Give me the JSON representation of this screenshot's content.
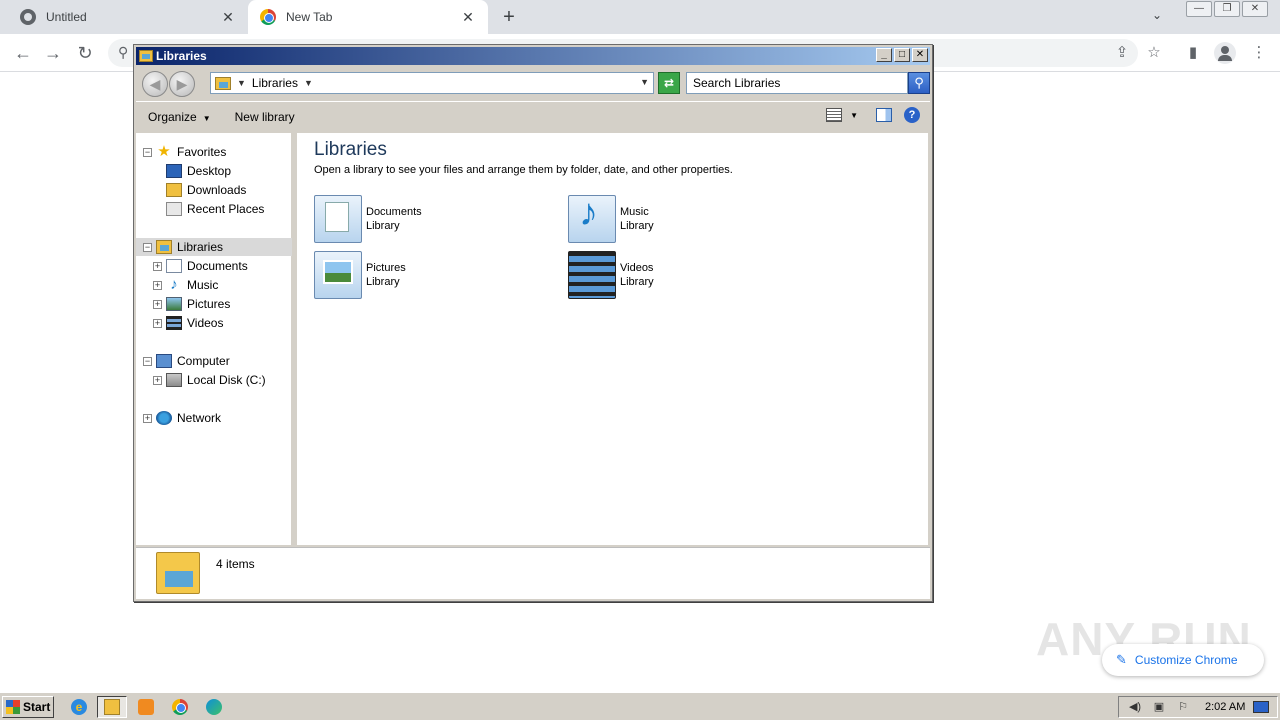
{
  "browser": {
    "tabs": [
      {
        "title": "Untitled",
        "close": "✕"
      },
      {
        "title": "New Tab",
        "close": "✕"
      }
    ],
    "new_tab": "+",
    "tab_search": "⌄",
    "window_controls": [
      "—",
      "❐",
      "✕"
    ],
    "nav": {
      "back": "←",
      "forward": "→",
      "reload": "↻"
    },
    "omnibox_icon": "search-icon",
    "toolbar_icons": [
      "share-icon",
      "star-icon",
      "side-panel-icon",
      "profile-icon",
      "menu-icon"
    ],
    "customize_label": "Customize Chrome",
    "watermark": "ANY RUN"
  },
  "explorer": {
    "title": "Libraries",
    "title_buttons": [
      "_",
      "□",
      "✕"
    ],
    "address": {
      "crumb": "Libraries"
    },
    "search_placeholder": "Search Libraries",
    "commands": {
      "organize": "Organize",
      "new_library": "New library"
    },
    "help": "?",
    "nav_tree": [
      {
        "label": "Favorites",
        "icon": "star-icon",
        "expander": "−",
        "level": 0
      },
      {
        "label": "Desktop",
        "icon": "desktop-icon",
        "level": 1
      },
      {
        "label": "Downloads",
        "icon": "downloads-icon",
        "level": 1
      },
      {
        "label": "Recent Places",
        "icon": "recent-places-icon",
        "level": 1
      },
      {
        "label": "Libraries",
        "icon": "libraries-icon",
        "expander": "−",
        "level": 0,
        "selected": true
      },
      {
        "label": "Documents",
        "icon": "documents-icon",
        "expander": "+",
        "level": 1
      },
      {
        "label": "Music",
        "icon": "music-icon",
        "expander": "+",
        "level": 1
      },
      {
        "label": "Pictures",
        "icon": "pictures-icon",
        "expander": "+",
        "level": 1
      },
      {
        "label": "Videos",
        "icon": "videos-icon",
        "expander": "+",
        "level": 1
      },
      {
        "label": "Computer",
        "icon": "computer-icon",
        "expander": "−",
        "level": 0
      },
      {
        "label": "Local Disk (C:)",
        "icon": "disk-icon",
        "expander": "+",
        "level": 1
      },
      {
        "label": "Network",
        "icon": "network-icon",
        "expander": "+",
        "level": 0
      }
    ],
    "heading": "Libraries",
    "subheading": "Open a library to see your files and arrange them by folder, date, and other properties.",
    "libraries": [
      {
        "name": "Documents",
        "type": "Library",
        "icon": "documents-library-icon"
      },
      {
        "name": "Music",
        "type": "Library",
        "icon": "music-library-icon"
      },
      {
        "name": "Pictures",
        "type": "Library",
        "icon": "pictures-library-icon"
      },
      {
        "name": "Videos",
        "type": "Library",
        "icon": "videos-library-icon"
      }
    ],
    "status": "4 items"
  },
  "taskbar": {
    "start_label": "Start",
    "apps": [
      "internet-explorer-icon",
      "explorer-icon",
      "media-player-icon",
      "chrome-icon",
      "edge-icon"
    ],
    "tray_icons": [
      "volume-icon",
      "network-tray-icon",
      "flag-icon"
    ],
    "clock": "2:02 AM"
  },
  "colors": {
    "title_gradient_start": "#0a246a",
    "title_gradient_end": "#a6caf0",
    "heading": "#1e395b",
    "chrome_accent": "#1a73e8"
  }
}
